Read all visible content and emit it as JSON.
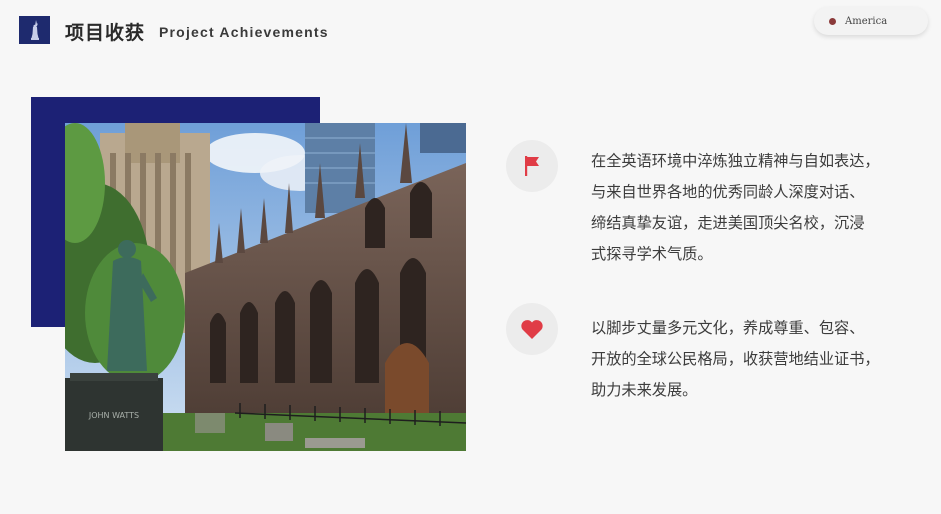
{
  "header": {
    "title_cn": "项目收获",
    "title_en": "Project Achievements",
    "logo_icon": "statue-of-liberty-icon"
  },
  "location_pill": {
    "label": "America",
    "dot_color": "#8b3a3a"
  },
  "accent_color": "#1c2175",
  "photo": {
    "subject": "trinity-church-photo",
    "statue_plaque": "JOHN WATTS"
  },
  "achievements": [
    {
      "icon": "flag-icon",
      "lines": [
        "在全英语环境中淬炼独立精神与自如表达，",
        "与来自世界各地的优秀同龄人深度对话、",
        "缔结真挚友谊，走进美国顶尖名校，沉浸",
        "式探寻学术气质。"
      ]
    },
    {
      "icon": "heart-icon",
      "lines": [
        "以脚步丈量多元文化，养成尊重、包容、",
        "开放的全球公民格局，收获营地结业证书，",
        "助力未来发展。"
      ]
    }
  ],
  "icon_color": "#e03c46"
}
